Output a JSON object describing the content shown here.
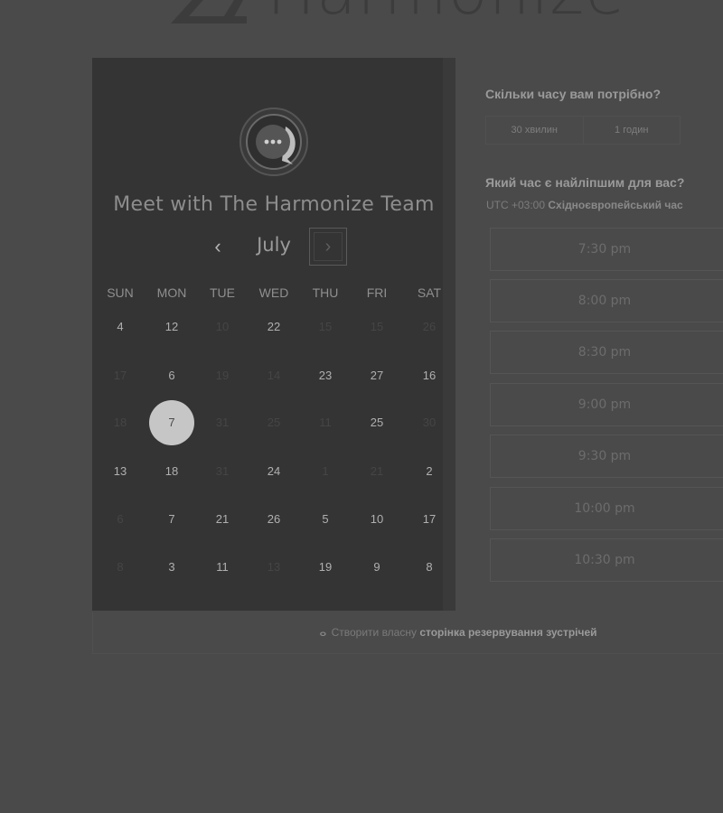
{
  "logo": {
    "text": "Harmonize"
  },
  "calendar": {
    "title": "Meet with The Harmonize Team",
    "month": "July",
    "prev_icon": "‹",
    "next_icon": "›",
    "weekdays": [
      "SUN",
      "MON",
      "TUE",
      "WED",
      "THU",
      "FRI",
      "SAT"
    ],
    "rows": [
      [
        {
          "t": "4"
        },
        {
          "t": "12"
        },
        {
          "t": "10",
          "d": true
        },
        {
          "t": "22"
        },
        {
          "t": "15",
          "d": true
        },
        {
          "t": "15",
          "d": true
        },
        {
          "t": "26",
          "d": true
        }
      ],
      [
        {
          "t": "17",
          "d": true
        },
        {
          "t": "6"
        },
        {
          "t": "19",
          "d": true
        },
        {
          "t": "14",
          "d": true
        },
        {
          "t": "23"
        },
        {
          "t": "27"
        },
        {
          "t": "16"
        }
      ],
      [
        {
          "t": "18",
          "d": true
        },
        {
          "t": "7",
          "s": true
        },
        {
          "t": "31",
          "d": true
        },
        {
          "t": "25",
          "d": true
        },
        {
          "t": "11",
          "d": true
        },
        {
          "t": "25"
        },
        {
          "t": "30",
          "d": true
        }
      ],
      [
        {
          "t": "13"
        },
        {
          "t": "18"
        },
        {
          "t": "31",
          "d": true
        },
        {
          "t": "24"
        },
        {
          "t": "1",
          "d": true
        },
        {
          "t": "21",
          "d": true
        },
        {
          "t": "2"
        }
      ],
      [
        {
          "t": "6",
          "d": true
        },
        {
          "t": "7"
        },
        {
          "t": "21"
        },
        {
          "t": "26"
        },
        {
          "t": "5"
        },
        {
          "t": "10"
        },
        {
          "t": "17"
        }
      ],
      [
        {
          "t": "8",
          "d": true
        },
        {
          "t": "3"
        },
        {
          "t": "11"
        },
        {
          "t": "13",
          "d": true
        },
        {
          "t": "19"
        },
        {
          "t": "9"
        },
        {
          "t": "8"
        }
      ]
    ]
  },
  "duration": {
    "question": "Скільки часу вам потрібно?",
    "options": [
      "30 хвилин",
      "1 годин"
    ]
  },
  "time": {
    "question": "Який час є найліпшим для вас?",
    "tz_offset": "UTC +03:00",
    "tz_name": "Східноєвропейський час",
    "slots": [
      "7:30 pm",
      "8:00 pm",
      "8:30 pm",
      "9:00 pm",
      "9:30 pm",
      "10:00 pm",
      "10:30 pm"
    ]
  },
  "footer": {
    "prefix": "Створити власну",
    "link": "сторінка резервування зустрічей"
  },
  "colors": {
    "background": "#4a4a4a",
    "panel": "#343434",
    "selected_day": "#c6c6c6"
  }
}
